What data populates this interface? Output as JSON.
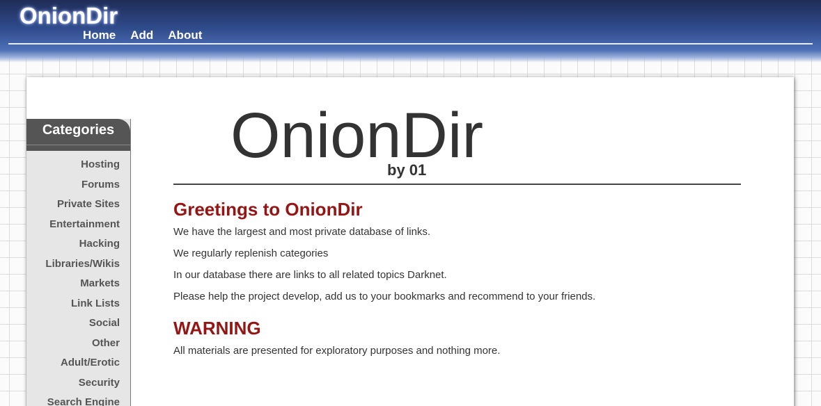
{
  "header": {
    "site_title": "OnionDir",
    "nav": [
      {
        "label": "Home"
      },
      {
        "label": "Add"
      },
      {
        "label": "About"
      }
    ]
  },
  "sidebar": {
    "title": "Categories",
    "items": [
      {
        "label": "Hosting"
      },
      {
        "label": "Forums"
      },
      {
        "label": "Private Sites"
      },
      {
        "label": "Entertainment"
      },
      {
        "label": "Hacking"
      },
      {
        "label": "Libraries/Wikis"
      },
      {
        "label": "Markets"
      },
      {
        "label": "Link Lists"
      },
      {
        "label": "Social"
      },
      {
        "label": "Other"
      },
      {
        "label": "Adult/Erotic"
      },
      {
        "label": "Security"
      },
      {
        "label": "Search Engine"
      }
    ]
  },
  "main": {
    "logo": "OnionDir",
    "byline": "by 01",
    "greeting_heading": "Greetings to OnionDir",
    "paragraphs": [
      "We have the largest and most private database of links.",
      "We regularly replenish categories",
      "In our database there are links to all related topics Darknet.",
      "Please help the project develop, add us to your bookmarks and recommend to your friends."
    ],
    "warning_heading": "WARNING",
    "warning_text": "All materials are presented for exploratory purposes and nothing more."
  },
  "colors": {
    "header_dark": "#1f2c57",
    "header_light": "#4d6fb6",
    "heading_red": "#951515",
    "sidebar_header": "#555555",
    "sidebar_bg": "#e6e6e6"
  }
}
